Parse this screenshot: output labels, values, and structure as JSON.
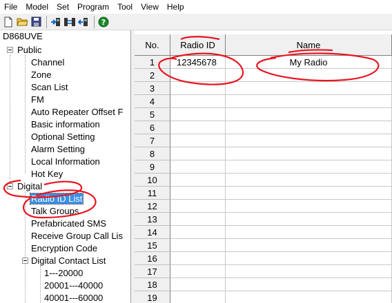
{
  "menu": [
    "File",
    "Model",
    "Set",
    "Program",
    "Tool",
    "View",
    "Help"
  ],
  "toolbar": {
    "buttons": [
      "new-file-icon",
      "open-folder-icon",
      "save-icon",
      "read-radio-icon",
      "write-radio-icon",
      "radio-info-icon",
      "help-icon"
    ]
  },
  "tree": {
    "root": "D868UVE",
    "public": {
      "label": "Public",
      "items": [
        "Channel",
        "Zone",
        "Scan List",
        "FM",
        "Auto Repeater Offset F",
        "Basic information",
        "Optional Setting",
        "Alarm Setting",
        "Local Information",
        "Hot Key"
      ]
    },
    "digital": {
      "label": "Digital",
      "items": [
        "Radio ID List",
        "Talk Groups",
        "Prefabricated SMS",
        "Receive Group Call Lis",
        "Encryption Code",
        "Digital Contact List"
      ],
      "selected": "Radio ID List",
      "contact_ranges": [
        "1---20000",
        "20001---40000",
        "40001---60000"
      ]
    }
  },
  "grid": {
    "headers": {
      "no": "No.",
      "radio_id": "Radio ID",
      "name": "Name"
    },
    "rows": [
      {
        "no": "1",
        "radio_id": "12345678",
        "name": "My Radio"
      },
      {
        "no": "2",
        "radio_id": "",
        "name": ""
      },
      {
        "no": "3",
        "radio_id": "",
        "name": ""
      },
      {
        "no": "4",
        "radio_id": "",
        "name": ""
      },
      {
        "no": "5",
        "radio_id": "",
        "name": ""
      },
      {
        "no": "6",
        "radio_id": "",
        "name": ""
      },
      {
        "no": "7",
        "radio_id": "",
        "name": ""
      },
      {
        "no": "8",
        "radio_id": "",
        "name": ""
      },
      {
        "no": "9",
        "radio_id": "",
        "name": ""
      },
      {
        "no": "10",
        "radio_id": "",
        "name": ""
      },
      {
        "no": "11",
        "radio_id": "",
        "name": ""
      },
      {
        "no": "12",
        "radio_id": "",
        "name": ""
      },
      {
        "no": "13",
        "radio_id": "",
        "name": ""
      },
      {
        "no": "14",
        "radio_id": "",
        "name": ""
      },
      {
        "no": "15",
        "radio_id": "",
        "name": ""
      },
      {
        "no": "16",
        "radio_id": "",
        "name": ""
      },
      {
        "no": "17",
        "radio_id": "",
        "name": ""
      },
      {
        "no": "18",
        "radio_id": "",
        "name": ""
      },
      {
        "no": "19",
        "radio_id": "",
        "name": ""
      }
    ]
  },
  "colors": {
    "annotation": "#e8141e",
    "selection": "#3a8ee6"
  }
}
